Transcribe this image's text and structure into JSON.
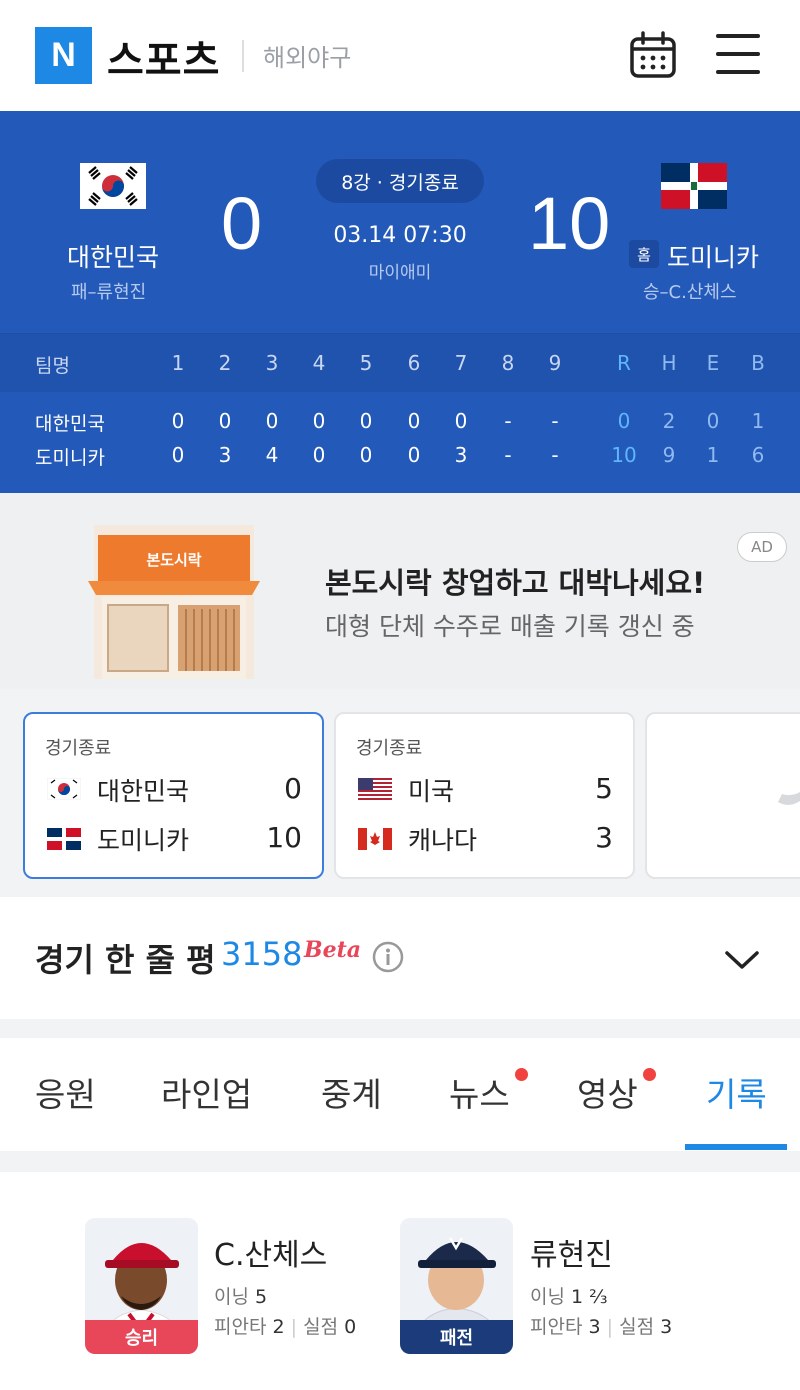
{
  "header": {
    "logo": "N",
    "brand": "스포츠",
    "section": "해외야구"
  },
  "game": {
    "away": {
      "name": "대한민국",
      "pitcher": "패–류현진",
      "score": "0"
    },
    "home": {
      "badge": "홈",
      "name": "도미니카",
      "pitcher": "승–C.산체스",
      "score": "10"
    },
    "status": "8강 · 경기종료",
    "datetime": "03.14 07:30",
    "venue": "마이애미"
  },
  "boxscore": {
    "team_header": "팀명",
    "innings": [
      "1",
      "2",
      "3",
      "4",
      "5",
      "6",
      "7",
      "8",
      "9"
    ],
    "totals": [
      "R",
      "H",
      "E",
      "B"
    ],
    "rows": [
      {
        "team": "대한민국",
        "innings": [
          "0",
          "0",
          "0",
          "0",
          "0",
          "0",
          "0",
          "-",
          "-"
        ],
        "totals": [
          "0",
          "2",
          "0",
          "1"
        ]
      },
      {
        "team": "도미니카",
        "innings": [
          "0",
          "3",
          "4",
          "0",
          "0",
          "0",
          "3",
          "-",
          "-"
        ],
        "totals": [
          "10",
          "9",
          "1",
          "6"
        ]
      }
    ]
  },
  "ad": {
    "badge": "AD",
    "store_sign": "본도시락",
    "title": "본도시락 창업하고 대박나세요!",
    "subtitle": "대형 단체 수주로 매출 기록 갱신 중"
  },
  "games": [
    {
      "status": "경기종료",
      "teams": [
        {
          "name": "대한민국",
          "score": "0"
        },
        {
          "name": "도미니카",
          "score": "10"
        }
      ]
    },
    {
      "status": "경기종료",
      "teams": [
        {
          "name": "미국",
          "score": "5"
        },
        {
          "name": "캐나다",
          "score": "3"
        }
      ]
    }
  ],
  "one_line": {
    "title": "경기 한 줄 평",
    "count": "3158",
    "beta": "Beta"
  },
  "tabs": [
    "응원",
    "라인업",
    "중계",
    "뉴스",
    "영상",
    "기록"
  ],
  "pitchers": [
    {
      "tag": "승리",
      "name": "C.산체스",
      "inning_label": "이닝",
      "inning": "5",
      "hits_label": "피안타",
      "hits": "2",
      "runs_label": "실점",
      "runs": "0"
    },
    {
      "tag": "패전",
      "name": "류현진",
      "inning_label": "이닝",
      "inning": "1 ⅔",
      "hits_label": "피안타",
      "hits": "3",
      "runs_label": "실점",
      "runs": "3"
    }
  ],
  "colors": {
    "accent": "#2359b8",
    "active_tab": "#1e88e5",
    "win": "#e8475a",
    "loss": "#1b3b7a"
  }
}
